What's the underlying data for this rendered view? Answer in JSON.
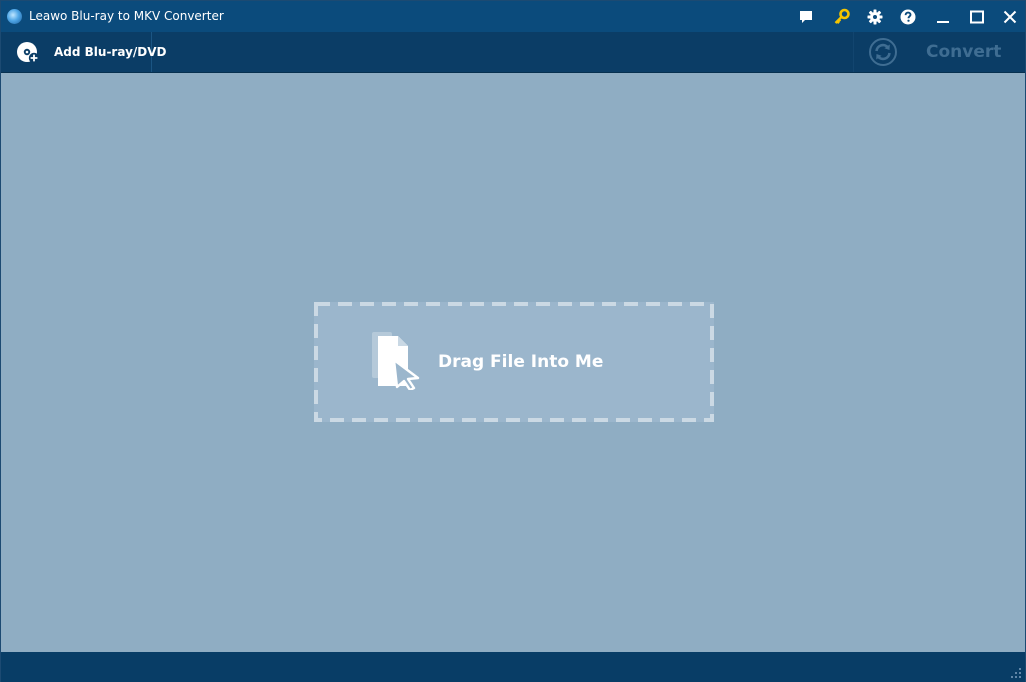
{
  "window": {
    "title": "Leawo Blu-ray to MKV Converter",
    "icons": [
      "app-logo-icon",
      "feedback-icon",
      "key-icon",
      "gear-icon",
      "help-icon",
      "minimize-icon",
      "maximize-icon",
      "close-icon"
    ]
  },
  "toolbar": {
    "add_label": "Add Blu-ray/DVD",
    "add_icon": "disc-add-icon",
    "convert_label": "Convert",
    "convert_icon": "convert-refresh-icon"
  },
  "dropzone": {
    "label": "Drag File Into Me",
    "icon": "file-cursor-icon"
  },
  "colors": {
    "titlebar": "#0b4b7c",
    "toolbar": "#0b3d66",
    "content": "#8fadc3",
    "dropzone": "#9bb6cc",
    "key_icon": "#f5c400",
    "convert_disabled": "#3f6d92"
  }
}
